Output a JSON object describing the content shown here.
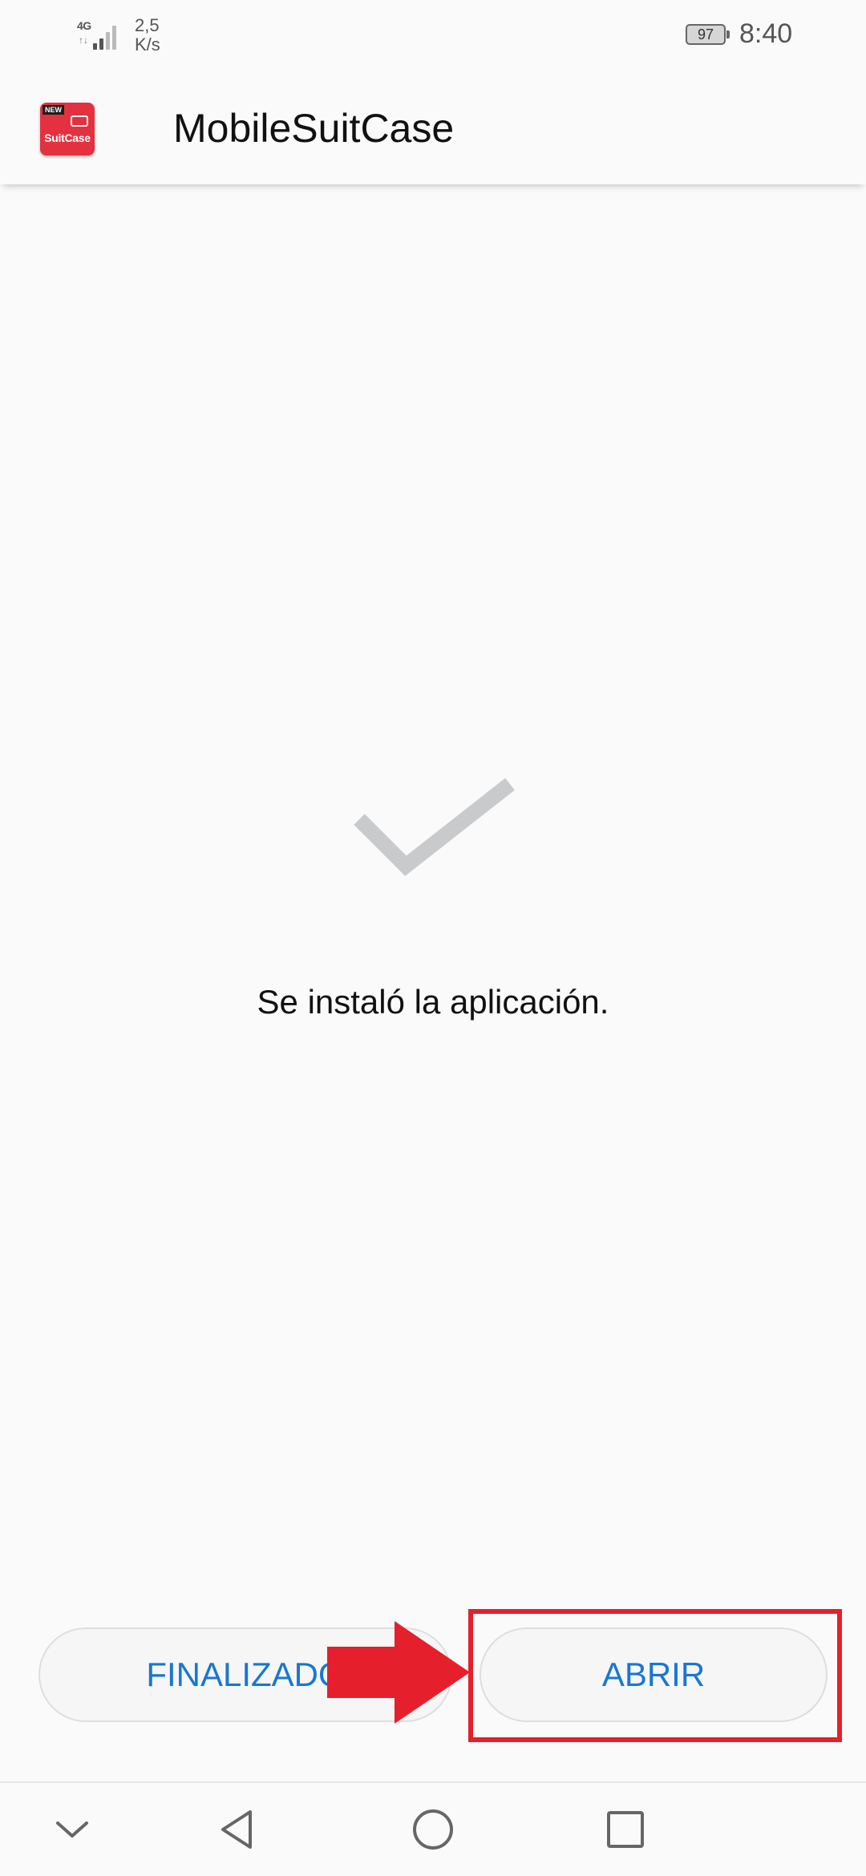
{
  "status_bar": {
    "network_type": "4G",
    "network_arrows": "↑↓",
    "speed_value": "2,5",
    "speed_unit": "K/s",
    "battery_level": "97",
    "time": "8:40"
  },
  "app_bar": {
    "icon": {
      "badge": "NEW",
      "name": "SuitCase"
    },
    "title": "MobileSuitCase"
  },
  "content": {
    "status_icon": "checkmark-icon",
    "message": "Se instaló la aplicación."
  },
  "buttons": {
    "done_label": "FINALIZADO",
    "open_label": "ABRIR"
  },
  "annotation": {
    "highlight_color": "#e51f2b",
    "arrow_icon": "red-arrow-icon"
  },
  "nav_bar": {
    "items": [
      "chevron-down-icon",
      "back-triangle-icon",
      "home-circle-icon",
      "recents-square-icon"
    ]
  },
  "colors": {
    "background": "#fafafa",
    "button_text": "#1877d2",
    "checkmark": "#c9cacc",
    "annotation_red": "#e51f2b"
  }
}
